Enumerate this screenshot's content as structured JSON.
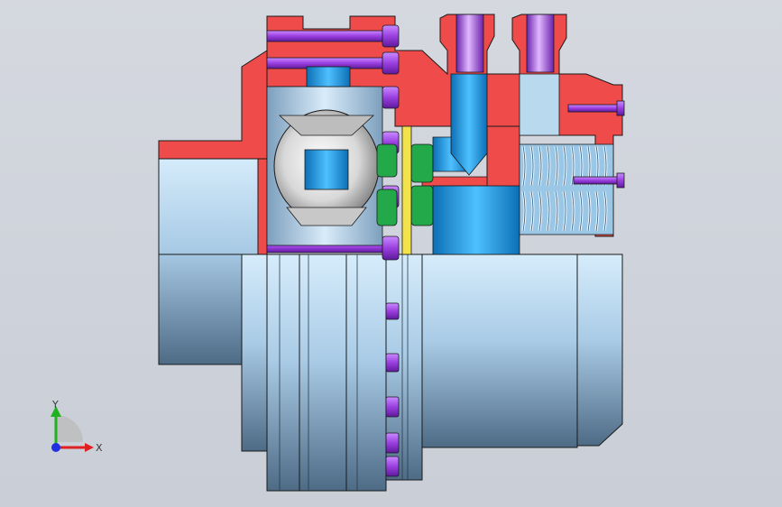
{
  "viewport": {
    "background": "#cfd4dc",
    "palette": {
      "section_red": "#ef4b4b",
      "steel_light": "#cfe3f5",
      "steel_mid": "#8fb6d6",
      "steel_dark": "#3f5a72",
      "bolt_purple": "#9b3fe0",
      "bolt_purple_light": "#d6a8ff",
      "blue_part": "#1596e8",
      "green_part": "#23a94a",
      "yellow_part": "#f3e34a",
      "outline": "#1a1a1a"
    }
  },
  "triad": {
    "x_label": "X",
    "y_label": "Y",
    "x_color": "#e02020",
    "y_color": "#20b020",
    "z_color": "#2030e0"
  }
}
